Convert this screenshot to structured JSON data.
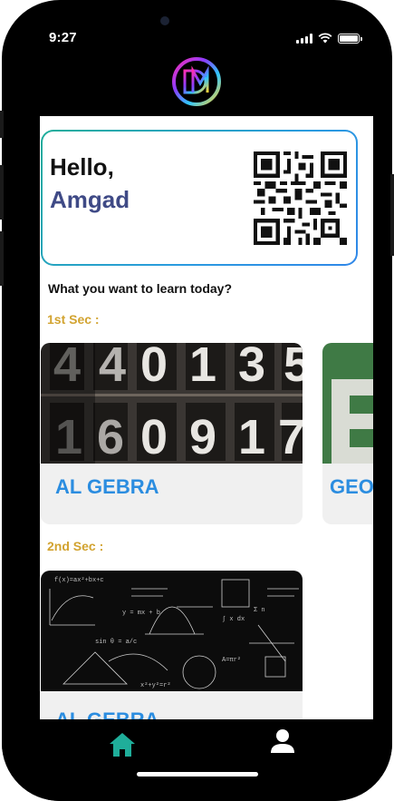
{
  "status": {
    "time": "9:27"
  },
  "greeting": {
    "hello": "Hello,",
    "name": "Amgad"
  },
  "prompt": "What you want to learn today?",
  "sections": [
    {
      "label": "1st Sec :",
      "courses": [
        {
          "name": "AL GEBRA"
        },
        {
          "name": "GEOM"
        }
      ]
    },
    {
      "label": "2nd Sec :",
      "courses": [
        {
          "name": "AL GEBRA"
        }
      ]
    }
  ],
  "nav": {
    "home_icon": "home-icon",
    "profile_icon": "user-icon"
  },
  "colors": {
    "accent_blue": "#2b8de0",
    "gold": "#d2a330",
    "name_purple": "#3f4a86",
    "home_teal": "#1fae9a"
  }
}
